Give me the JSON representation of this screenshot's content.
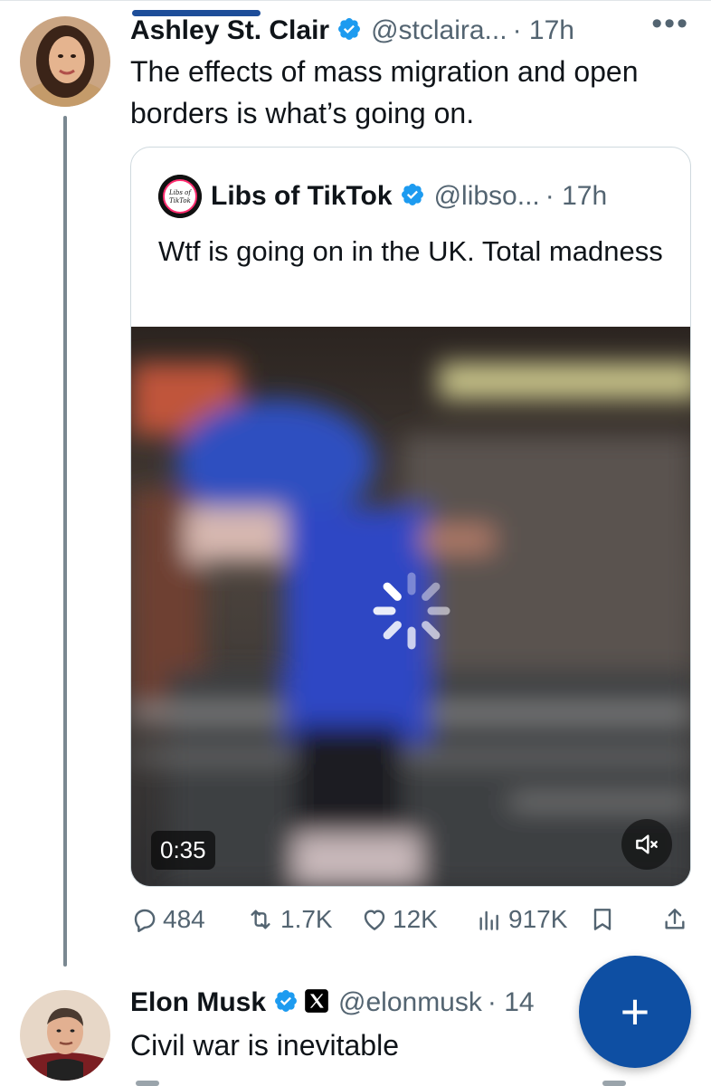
{
  "tweet1": {
    "name": "Ashley St. Clair",
    "handle": "@stclaira...",
    "time": "· 17h",
    "more": "•••",
    "text": "The effects of mass migration and open borders is what’s going on."
  },
  "quote": {
    "logo_text": "Libs of TikTok",
    "name": "Libs of TikTok",
    "handle": "@libso...",
    "time": "· 17h",
    "text": "Wtf is going on in the UK. Total madness",
    "video": {
      "duration": "0:35"
    }
  },
  "actions": {
    "replies": "484",
    "reposts": "1.7K",
    "likes": "12K",
    "views": "917K"
  },
  "tweet2": {
    "name": "Elon Musk",
    "handle": "@elonmusk",
    "time": "· 14",
    "text": "Civil war is inevitable"
  },
  "fab": {
    "label": "+"
  },
  "colors": {
    "verified": "#1d9bf0",
    "fab": "#0e4fa3",
    "muted_text": "#536471"
  }
}
